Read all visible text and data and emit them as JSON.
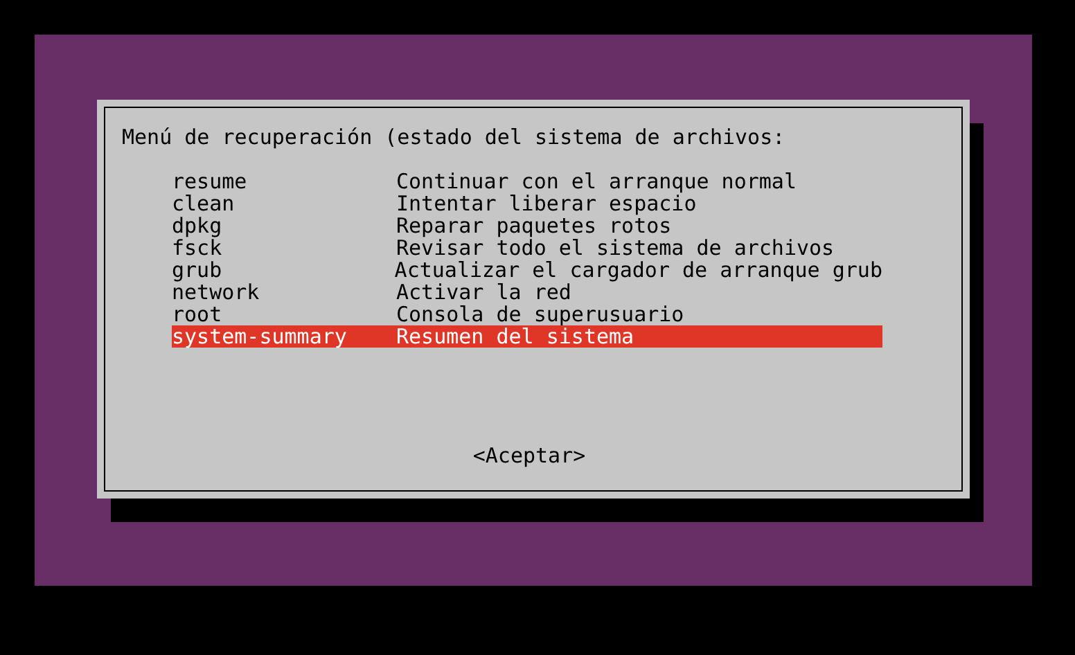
{
  "dialog": {
    "title": "Menú de recuperación (estado del sistema de archivos:",
    "items": [
      {
        "name": "resume",
        "description": "Continuar con el arranque normal",
        "selected": false
      },
      {
        "name": "clean",
        "description": "Intentar liberar espacio",
        "selected": false
      },
      {
        "name": "dpkg",
        "description": "Reparar paquetes rotos",
        "selected": false
      },
      {
        "name": "fsck",
        "description": "Revisar todo el sistema de archivos",
        "selected": false
      },
      {
        "name": "grub",
        "description": "Actualizar el cargador de arranque grub",
        "selected": false
      },
      {
        "name": "network",
        "description": "Activar la red",
        "selected": false
      },
      {
        "name": "root",
        "description": "Consola de superusuario",
        "selected": false
      },
      {
        "name": "system-summary",
        "description": "Resumen del sistema",
        "selected": true
      }
    ],
    "button": "<Aceptar>"
  }
}
